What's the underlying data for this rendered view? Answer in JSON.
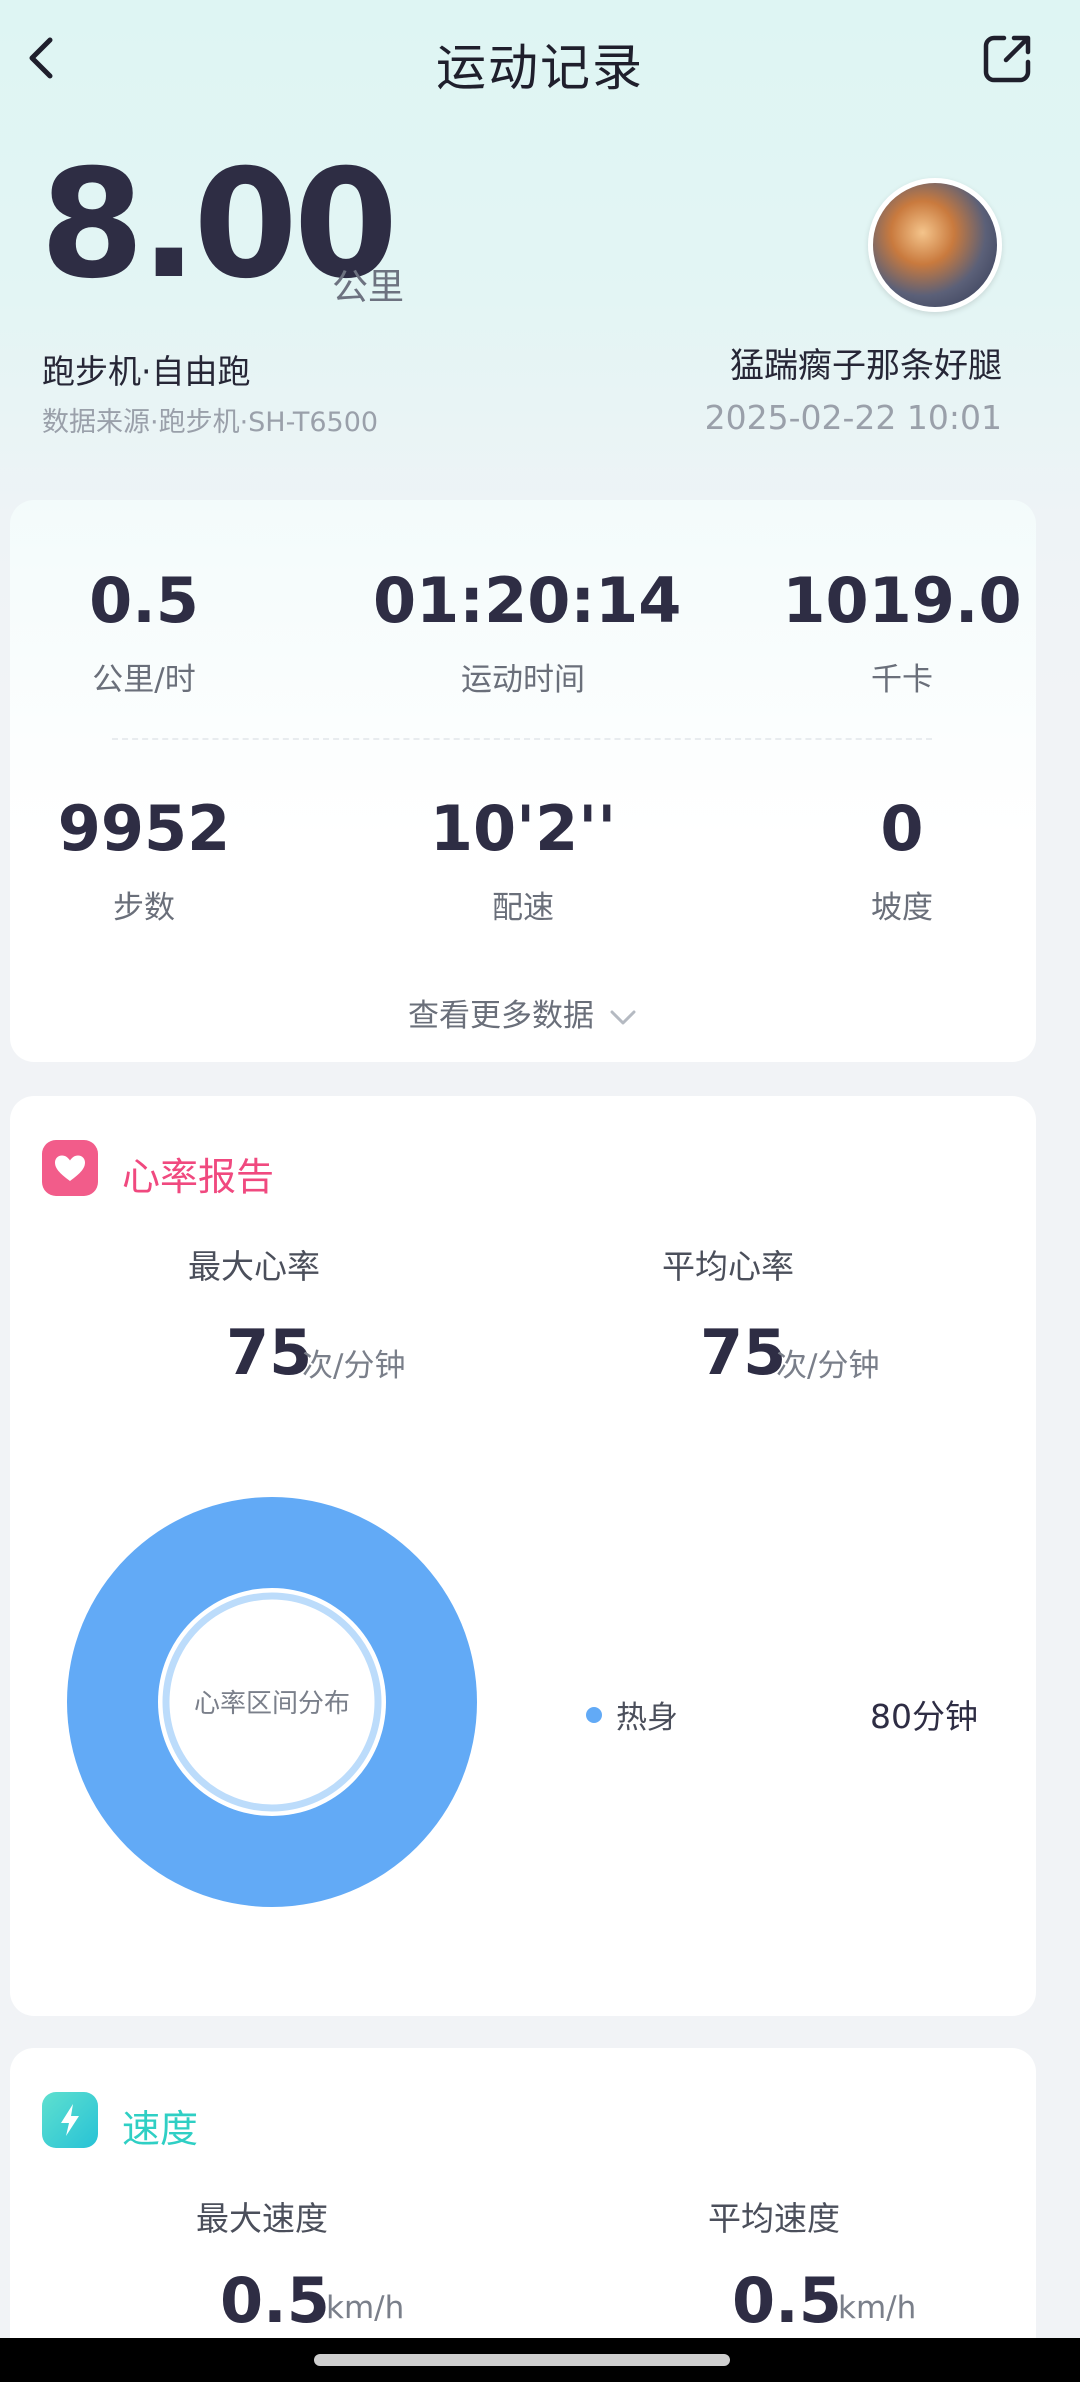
{
  "nav": {
    "title": "运动记录",
    "back_icon": "chevron-left-icon",
    "share_icon": "share-icon"
  },
  "summary": {
    "distance": "8.00",
    "distance_unit": "公里",
    "activity": "跑步机·自由跑",
    "source": "数据来源·跑步机·SH-T6500",
    "username": "猛踹瘸子那条好腿",
    "datetime": "2025-02-22 10:01"
  },
  "stats": [
    {
      "value": "0.5",
      "label": "公里/时"
    },
    {
      "value": "01:20:14",
      "label": "运动时间"
    },
    {
      "value": "1019.0",
      "label": "千卡"
    },
    {
      "value": "9952",
      "label": "步数"
    },
    {
      "value": "10'2''",
      "label": "配速"
    },
    {
      "value": "0",
      "label": "坡度"
    }
  ],
  "more_label": "查看更多数据",
  "heart_rate": {
    "title": "心率报告",
    "accent": "#f25c8a",
    "max_label": "最大心率",
    "max_value": "75",
    "avg_label": "平均心率",
    "avg_value": "75",
    "unit": "次/分钟",
    "donut_center": "心率区间分布",
    "zones": [
      {
        "name": "热身",
        "value": "80分钟",
        "color": "#62aaf6",
        "share": 1.0
      }
    ]
  },
  "speed": {
    "title": "速度",
    "accent": "#2fcfc4",
    "max_label": "最大速度",
    "max_value": "0.5",
    "avg_label": "平均速度",
    "avg_value": "0.5",
    "unit": "km/h"
  }
}
